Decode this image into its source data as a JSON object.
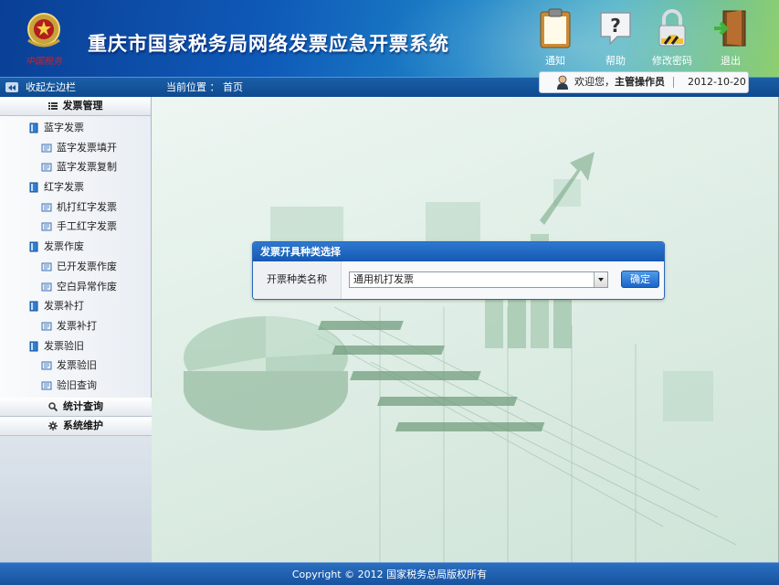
{
  "header": {
    "title": "重庆市国家税务局网络发票应急开票系统",
    "logo_text": "中国税务",
    "buttons": [
      {
        "label": "通知",
        "icon": "clipboard-icon"
      },
      {
        "label": "帮助",
        "icon": "help-icon"
      },
      {
        "label": "修改密码",
        "icon": "lock-icon"
      },
      {
        "label": "退出",
        "icon": "exit-door-icon"
      }
    ]
  },
  "subbar": {
    "collapse_label": "收起左边栏",
    "breadcrumb": "当前位置 ： 首页"
  },
  "welcome": {
    "prefix": "欢迎您，",
    "user": "主管操作员",
    "date": "2012-10-20"
  },
  "sidebar": {
    "sections": [
      {
        "label": "发票管理",
        "icon": "list-icon"
      },
      {
        "label": "统计查询",
        "icon": "search-icon"
      },
      {
        "label": "系统维护",
        "icon": "gear-icon"
      }
    ],
    "tree": [
      {
        "label": "蓝字发票",
        "level": 1
      },
      {
        "label": "蓝字发票填开",
        "level": 2
      },
      {
        "label": "蓝字发票复制",
        "level": 2
      },
      {
        "label": "红字发票",
        "level": 1
      },
      {
        "label": "机打红字发票",
        "level": 2
      },
      {
        "label": "手工红字发票",
        "level": 2
      },
      {
        "label": "发票作废",
        "level": 1
      },
      {
        "label": "已开发票作废",
        "level": 2
      },
      {
        "label": "空白异常作废",
        "level": 2
      },
      {
        "label": "发票补打",
        "level": 1
      },
      {
        "label": "发票补打",
        "level": 2
      },
      {
        "label": "发票验旧",
        "level": 1
      },
      {
        "label": "发票验旧",
        "level": 2
      },
      {
        "label": "验旧查询",
        "level": 2
      }
    ]
  },
  "dialog": {
    "title": "发票开具种类选择",
    "field_label": "开票种类名称",
    "select_value": "通用机打发票",
    "confirm_label": "确定"
  },
  "footer": {
    "copyright": "Copyright © 2012 国家税务总局版权所有"
  },
  "colors": {
    "header_start": "#0a3f95",
    "header_end": "#8fcf6e",
    "accent": "#1459b3",
    "footer": "#17539f"
  }
}
